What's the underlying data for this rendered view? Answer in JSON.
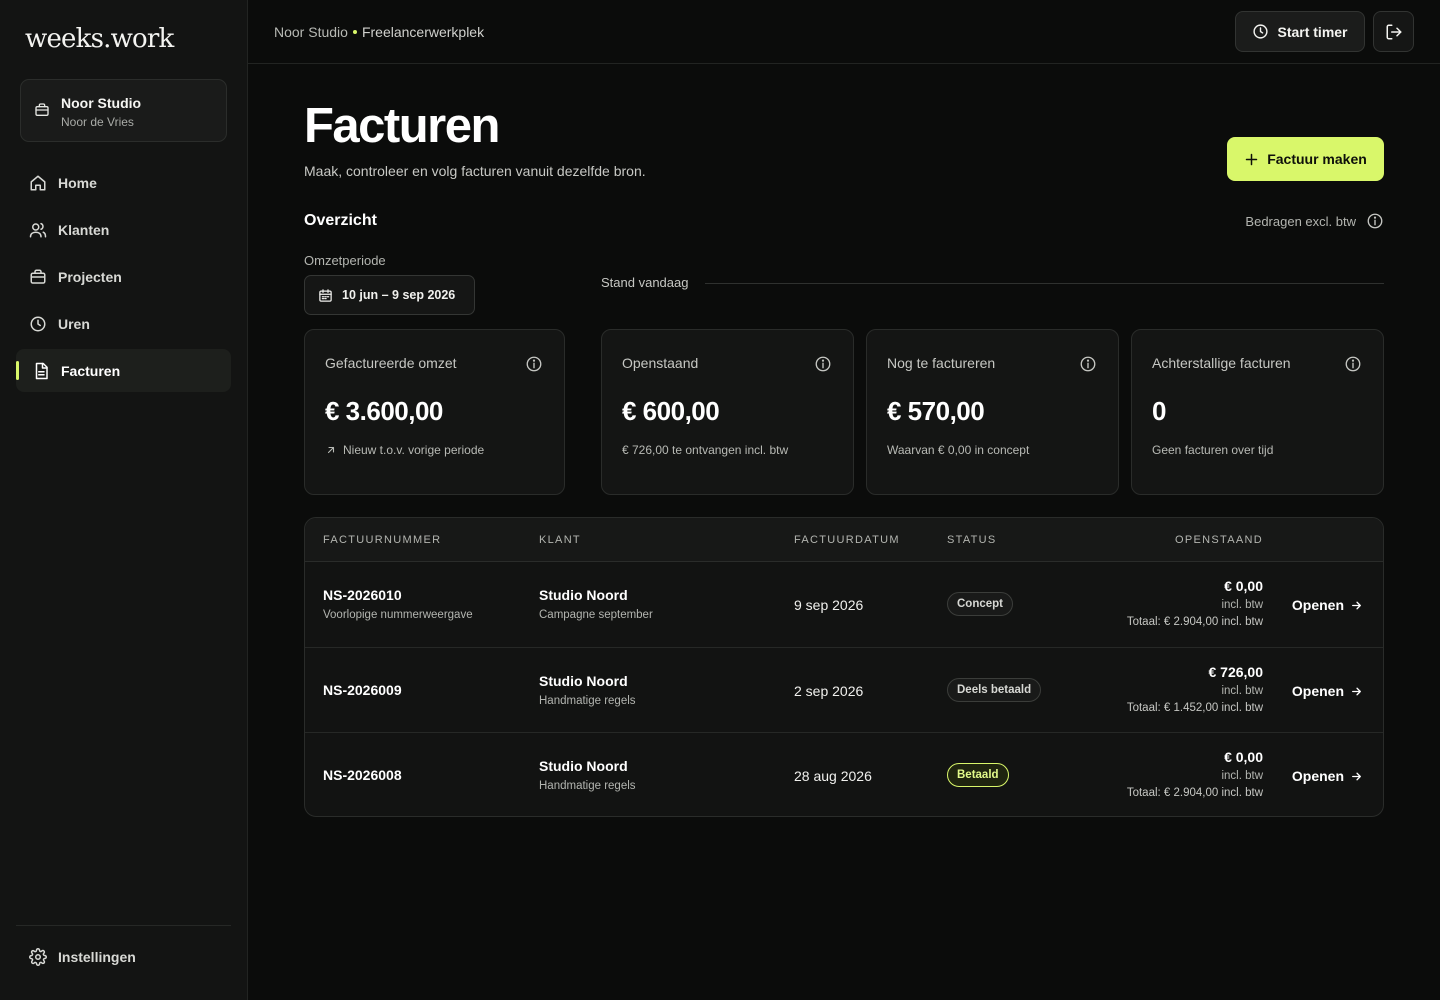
{
  "app": {
    "logo": "weeks.work"
  },
  "workspace": {
    "name": "Noor Studio",
    "user": "Noor de Vries"
  },
  "sidebar": {
    "items": [
      {
        "label": "Home",
        "icon": "home-icon"
      },
      {
        "label": "Klanten",
        "icon": "users-icon"
      },
      {
        "label": "Projecten",
        "icon": "briefcase-icon"
      },
      {
        "label": "Uren",
        "icon": "clock-icon"
      },
      {
        "label": "Facturen",
        "icon": "document-icon",
        "active": true
      }
    ],
    "settings": "Instellingen"
  },
  "topbar": {
    "breadcrumb": [
      "Noor Studio",
      "Freelancerwerkplek"
    ],
    "start_timer": "Start timer"
  },
  "header": {
    "title": "Facturen",
    "subtitle": "Maak, controleer en volg facturen vanuit dezelfde bron.",
    "create_button": "Factuur maken"
  },
  "overview": {
    "title": "Overzicht",
    "amounts_note": "Bedragen excl. btw",
    "period_label": "Omzetperiode",
    "period_value": "10 jun – 9 sep 2026",
    "stand_label": "Stand vandaag"
  },
  "cards": [
    {
      "label": "Gefactureerde omzet",
      "value": "€ 3.600,00",
      "note": "Nieuw t.o.v. vorige periode"
    },
    {
      "label": "Openstaand",
      "value": "€ 600,00",
      "note": "€ 726,00 te ontvangen incl. btw"
    },
    {
      "label": "Nog te factureren",
      "value": "€ 570,00",
      "note": "Waarvan € 0,00 in concept"
    },
    {
      "label": "Achterstallige facturen",
      "value": "0",
      "note": "Geen facturen over tijd"
    }
  ],
  "table": {
    "headers": [
      "FACTUURNUMMER",
      "KLANT",
      "FACTUURDATUM",
      "STATUS",
      "OPENSTAAND"
    ],
    "rows": [
      {
        "number": "NS-2026010",
        "number_sub": "Voorlopige nummerweergave",
        "client": "Studio Noord",
        "client_sub": "Campagne september",
        "date": "9 sep 2026",
        "status": "Concept",
        "open": "€ 0,00",
        "vat": "incl. btw",
        "total": "Totaal: € 2.904,00 incl. btw",
        "action": "Openen"
      },
      {
        "number": "NS-2026009",
        "number_sub": "",
        "client": "Studio Noord",
        "client_sub": "Handmatige regels",
        "date": "2 sep 2026",
        "status": "Deels betaald",
        "open": "€ 726,00",
        "vat": "incl. btw",
        "total": "Totaal: € 1.452,00 incl. btw",
        "action": "Openen"
      },
      {
        "number": "NS-2026008",
        "number_sub": "",
        "client": "Studio Noord",
        "client_sub": "Handmatige regels",
        "date": "28 aug 2026",
        "status": "Betaald",
        "open": "€ 0,00",
        "vat": "incl. btw",
        "total": "Totaal: € 2.904,00 incl. btw",
        "action": "Openen"
      }
    ]
  },
  "colors": {
    "accent": "#d9f76a",
    "background": "#0b0c0b",
    "sidebar": "#131413"
  }
}
